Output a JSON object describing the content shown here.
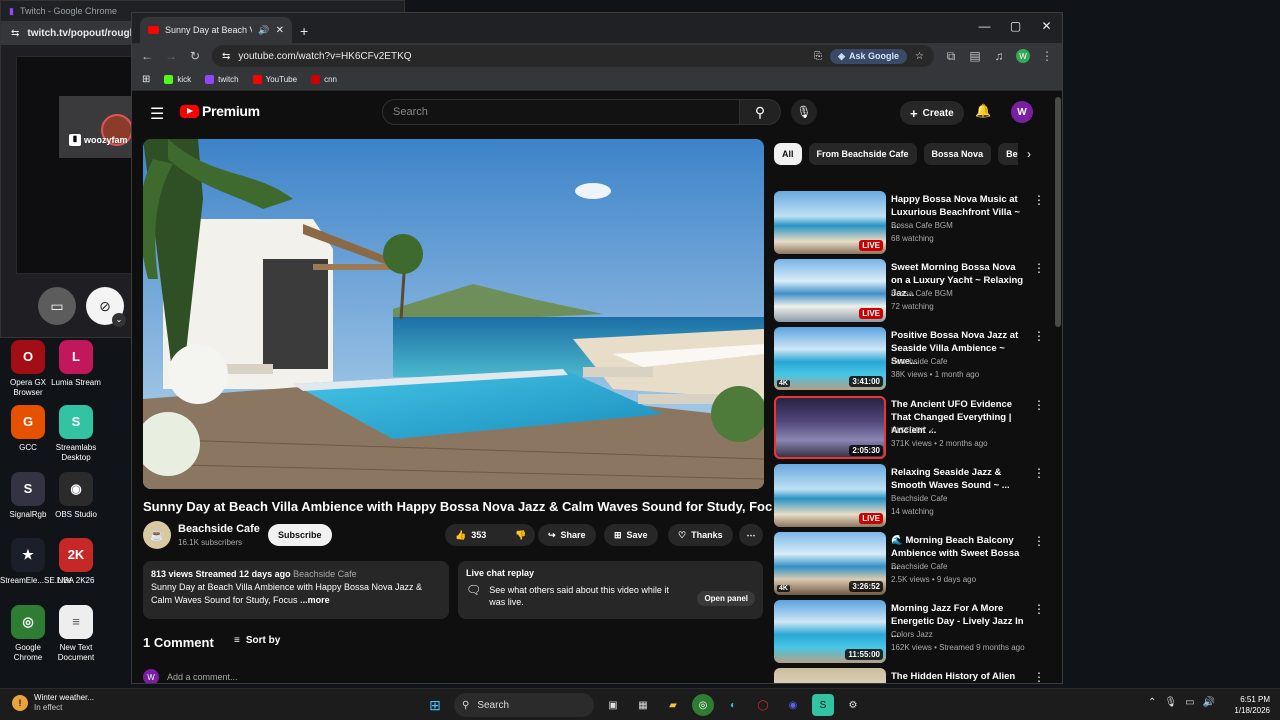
{
  "background_window": {
    "title": "Twitch - Google Chrome",
    "url": "twitch.tv/popout/rough_",
    "streamer_label": "woozyfam"
  },
  "desktop_icons": [
    {
      "label": "Opera GX Browser",
      "color": "#a30d16",
      "glyph": "O"
    },
    {
      "label": "Lumia Stream",
      "color": "#c2185b",
      "glyph": "L"
    },
    {
      "label": "GCC",
      "color": "#e65100",
      "glyph": "G"
    },
    {
      "label": "Streamlabs Desktop",
      "color": "#31c3a2",
      "glyph": "S"
    },
    {
      "label": "SignalRgb",
      "color": "#333344",
      "glyph": "S"
    },
    {
      "label": "OBS Studio",
      "color": "#2b2b2b",
      "glyph": "◉"
    },
    {
      "label": "StreamEle...SE.Live",
      "color": "#1b1f2a",
      "glyph": "★"
    },
    {
      "label": "NBA 2K26",
      "color": "#c62828",
      "glyph": "2K"
    },
    {
      "label": "Google Chrome",
      "color": "#2e7d32",
      "glyph": "◎"
    },
    {
      "label": "New Text Document",
      "color": "#eeeeee",
      "glyph": "≡"
    }
  ],
  "chrome": {
    "tab_title": "Sunny Day at Beach Villa Ambience",
    "url": "youtube.com/watch?v=HK6CFv2ETKQ",
    "ask_google": "Ask Google",
    "profile_initial": "W",
    "bookmarks": [
      {
        "label": "kick",
        "color": "#53fc18"
      },
      {
        "label": "twitch",
        "color": "#9146ff"
      },
      {
        "label": "YouTube",
        "color": "#ff0000"
      },
      {
        "label": "cnn",
        "color": "#cc0000"
      }
    ]
  },
  "youtube": {
    "brand": "Premium",
    "search_placeholder": "Search",
    "create_label": "Create",
    "avatar_initial": "W",
    "video": {
      "title": "Sunny Day at Beach Villa Ambience with Happy Bossa Nova Jazz & Calm Waves Sound for Study, Focus",
      "channel": "Beachside Cafe",
      "subscribers": "16.1K subscribers",
      "subscribe_label": "Subscribe",
      "likes": "353",
      "share_label": "Share",
      "save_label": "Save",
      "thanks_label": "Thanks",
      "description_meta": "813 views  Streamed 12 days ago",
      "description_tag": "Beachside Cafe",
      "description_text": "Sunny Day at Beach Villa Ambience with Happy Bossa Nova Jazz & Calm Waves Sound for Study, Focus",
      "more_label": "...more"
    },
    "live_chat": {
      "heading": "Live chat replay",
      "text": "See what others said about this video while it was live.",
      "button": "Open panel"
    },
    "comments": {
      "heading": "1 Comment",
      "sort_label": "Sort by",
      "add_placeholder": "Add a comment..."
    },
    "chips": [
      "All",
      "From Beachside Cafe",
      "Bossa Nova",
      "Beach"
    ],
    "recommendations": [
      {
        "title": "Happy Bossa Nova Music at Luxurious Beachfront Villa ~ ...",
        "channel": "Bossa Cafe BGM",
        "meta": "68 watching",
        "badge": "LIVE",
        "live": true,
        "fourk": false,
        "theme": "beach"
      },
      {
        "title": "Sweet Morning Bossa Nova on a Luxury Yacht ~ Relaxing Jaz...",
        "channel": "Bossa Cafe BGM",
        "meta": "72 watching",
        "badge": "LIVE",
        "live": true,
        "fourk": false,
        "theme": "yacht"
      },
      {
        "title": "Positive Bossa Nova Jazz at Seaside Villa Ambience ~ Swe...",
        "channel": "Beachside Cafe",
        "meta": "38K views • 1 month ago",
        "badge": "3:41:00",
        "live": false,
        "fourk": true,
        "theme": "pool"
      },
      {
        "title": "The Ancient UFO Evidence That Changed Everything | Ancient ...",
        "channel": "HISTORY ✓",
        "meta": "371K views • 2 months ago",
        "badge": "2:05:30",
        "live": false,
        "fourk": false,
        "theme": "ufo"
      },
      {
        "title": "Relaxing Seaside Jazz & Smooth Waves Sound ~ ...",
        "channel": "Beachside Cafe",
        "meta": "14 watching",
        "badge": "LIVE",
        "live": true,
        "fourk": false,
        "theme": "beach"
      },
      {
        "title": "🌊 Morning Beach Balcony Ambience with Sweet Bossa ...",
        "channel": "Beachside Cafe",
        "meta": "2.5K views • 9 days ago",
        "badge": "3:26:52",
        "live": false,
        "fourk": true,
        "theme": "balcony"
      },
      {
        "title": "Morning Jazz For A More Energetic Day - Lively Jazz In ...",
        "channel": "Colors Jazz",
        "meta": "162K views • Streamed 9 months ago",
        "badge": "11:55:00",
        "live": false,
        "fourk": false,
        "theme": "pool"
      },
      {
        "title": "The Hidden History of Alien Wars *Marathon* | Ancient ...",
        "channel": "",
        "meta": "",
        "badge": "",
        "live": false,
        "fourk": false,
        "theme": "stone"
      }
    ]
  },
  "taskbar": {
    "weather_title": "Winter weather...",
    "weather_sub": "In effect",
    "search_label": "Search",
    "time": "6:51 PM",
    "date": "1/18/2026"
  }
}
